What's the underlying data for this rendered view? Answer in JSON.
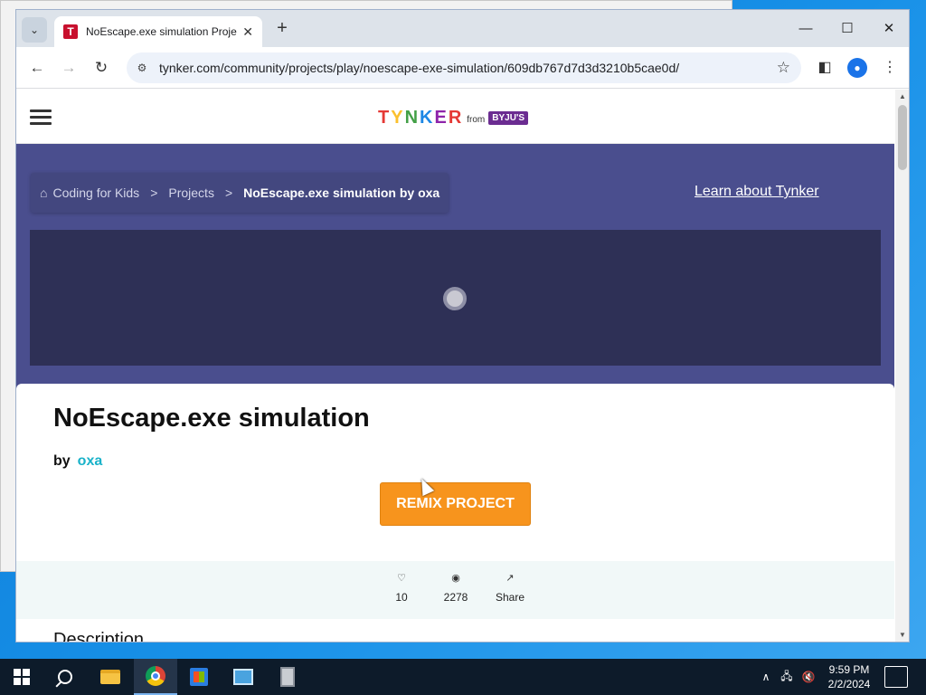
{
  "browser": {
    "tab_title": "NoEscape.exe simulation Proje",
    "favicon_letter": "T",
    "url": "tynker.com/community/projects/play/noescape-exe-simulation/609db767d7d3d3210b5cae0d/"
  },
  "site": {
    "logo_text": "TYNKER",
    "logo_from": "from",
    "logo_partner": "BYJU'S",
    "breadcrumb": {
      "home": "Coding for Kids",
      "sep": ">",
      "projects": "Projects",
      "current": "NoEscape.exe simulation by oxa"
    },
    "learn_link": "Learn about Tynker"
  },
  "project": {
    "title": "NoEscape.exe simulation",
    "by_label": "by",
    "author": "oxa",
    "remix_label": "REMIX PROJECT",
    "likes": "10",
    "views": "2278",
    "share_label": "Share",
    "description_heading": "Description"
  },
  "taskbar": {
    "time": "9:59 PM",
    "date": "2/2/2024"
  },
  "colors": {
    "accent_orange": "#f7941d",
    "header_purple": "#4a4e8e",
    "author_teal": "#19b2c9"
  }
}
